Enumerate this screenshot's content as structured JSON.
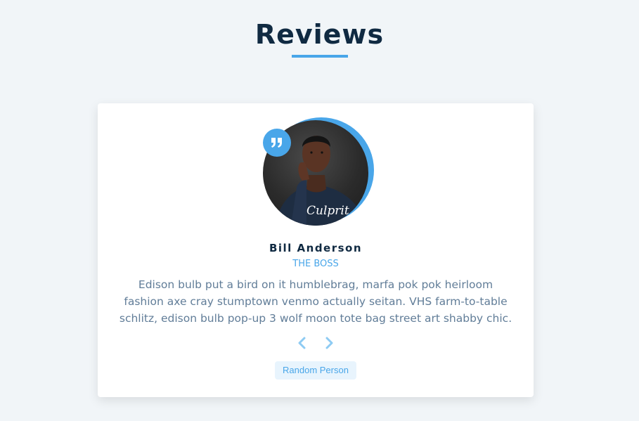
{
  "header": {
    "title": "Reviews"
  },
  "review": {
    "author": "Bill Anderson",
    "job": "THE BOSS",
    "text": "Edison bulb put a bird on it humblebrag, marfa pok pok heirloom fashion axe cray stumptown venmo actually seitan. VHS farm-to-table schlitz, edison bulb pop-up 3 wolf moon tote bag street art shabby chic.",
    "shirt_text": "Culprit"
  },
  "controls": {
    "prev_icon": "chevron-left-icon",
    "next_icon": "chevron-right-icon",
    "random_label": "Random Person"
  },
  "icons": {
    "quote": "quote-right-icon"
  },
  "colors": {
    "accent": "#49a6e9",
    "title": "#102a42",
    "body_text": "#617d98",
    "background": "#f1f5f8",
    "button_bg": "#e8f4fd"
  }
}
